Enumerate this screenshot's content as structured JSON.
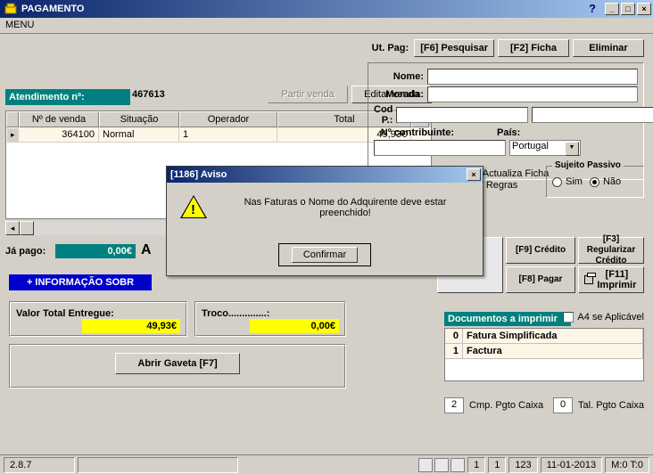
{
  "window": {
    "title": "PAGAMENTO",
    "menu": "MENU"
  },
  "attendance": {
    "label": "Atendimento nº:",
    "value": "467613"
  },
  "buttons": {
    "partir": "Partir venda",
    "editar": "Editar venda"
  },
  "grid": {
    "headers": [
      "Nº de venda",
      "Situação",
      "Operador",
      "Total"
    ],
    "row": {
      "num": "364100",
      "situacao": "Normal",
      "operador": "1",
      "total": "49,93€"
    }
  },
  "ja_pago": {
    "label": "Já pago:",
    "value": "0,00€",
    "letter": "A"
  },
  "info_bar": "+ INFORMAÇÃO SOBR",
  "entregue": {
    "label": "Valor Total Entregue:",
    "value": "49,93€"
  },
  "troco": {
    "label": "Troco..............:",
    "value": "0,00€"
  },
  "gaveta": "Abrir Gaveta [F7]",
  "utpag": {
    "label": "Ut. Pag:",
    "pesquisar": "[F6] Pesquisar",
    "ficha": "[F2] Ficha",
    "eliminar": "Eliminar"
  },
  "client": {
    "nome_lbl": "Nome:",
    "morada_lbl": "Morada:",
    "codp_lbl": "Cod P.:",
    "contrib_lbl": "Nº contribuinte:",
    "pais_lbl": "País:",
    "pais_val": "Portugal"
  },
  "checks": {
    "cria": "Cria \\ Actualiza Ficha",
    "valida": "Valida Regras"
  },
  "sujeito": {
    "legend": "Sujeito Passivo",
    "sim": "Sim",
    "nao": "Não"
  },
  "rbuttons": {
    "credito": "[F9] Crédito",
    "regularizar": "[F3] Regularizar Crédito",
    "pagar": "[F8] Pagar",
    "imprimir": "[F11] Imprimir"
  },
  "docs": {
    "header": "Documentos a imprimir",
    "a4": "A4 se Aplicável",
    "rows": [
      {
        "n": "0",
        "name": "Fatura Simplificada"
      },
      {
        "n": "1",
        "name": "Factura"
      }
    ]
  },
  "cmp": {
    "n": "2",
    "label": "Cmp. Pgto Caixa"
  },
  "tal": {
    "n": "0",
    "label": "Tal. Pgto Caixa"
  },
  "status": {
    "ver": "2.8.7",
    "a": "1",
    "b": "1",
    "c": "123",
    "date": "11-01-2013",
    "mt": "M:0 T:0"
  },
  "dialog": {
    "title": "[1186] Aviso",
    "text": "Nas Faturas o Nome do Adquirente deve estar preenchido!",
    "confirm": "Confirmar"
  }
}
